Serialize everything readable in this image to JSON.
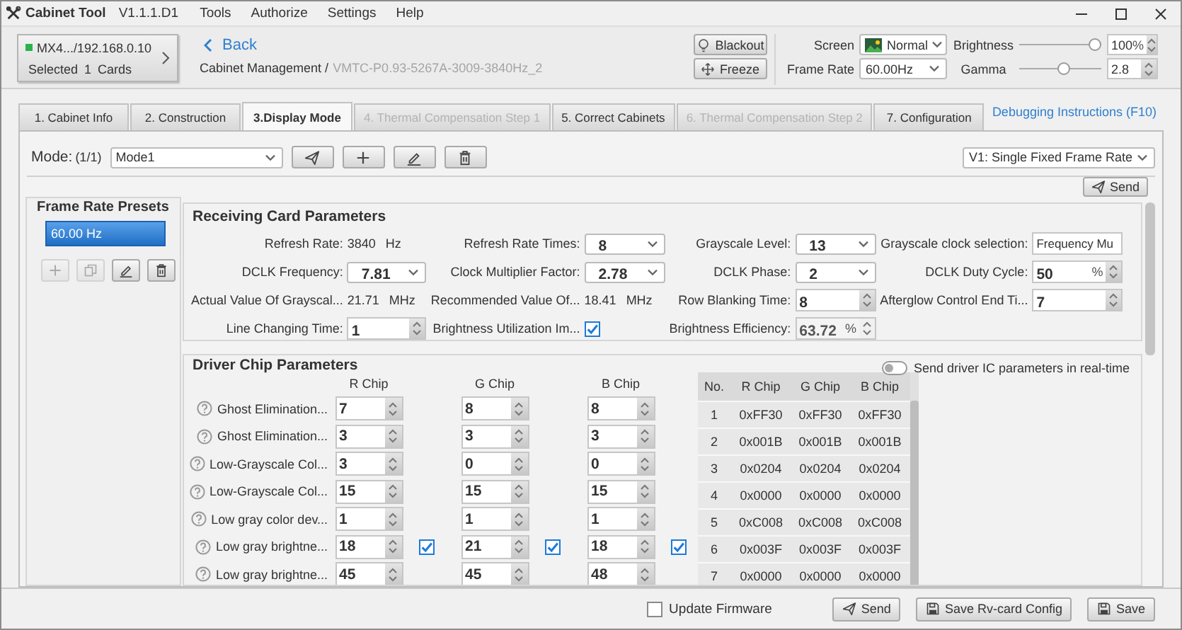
{
  "app": {
    "title": "Cabinet Tool",
    "version": "V1.1.1.D1"
  },
  "menu": [
    "Tools",
    "Authorize",
    "Settings",
    "Help"
  ],
  "device": {
    "name": "MX4.../192.168.0.10",
    "selection": "Selected 1 Cards",
    "online": true
  },
  "back": "Back",
  "breadcrumb": {
    "parent": "Cabinet Management /",
    "current": "VMTC-P0.93-5267A-3009-3840Hz_2"
  },
  "actions": [
    {
      "label": "Blackout",
      "kind": "blackout"
    },
    {
      "label": "Freeze",
      "kind": "freeze"
    }
  ],
  "screen": {
    "label": "Screen",
    "value": "Normal"
  },
  "brightness": {
    "label": "Brightness",
    "level": 1,
    "value": "100",
    "unit": "%"
  },
  "frame_rate": {
    "label": "Frame Rate",
    "value": "60.00Hz"
  },
  "gamma": {
    "label": "Gamma",
    "level": 0.55,
    "value": "2.8"
  },
  "tabs": [
    {
      "label": "1. Cabinet Info",
      "selected": false,
      "disabled": false
    },
    {
      "label": "2. Construction",
      "selected": false,
      "disabled": false
    },
    {
      "label": "3.Display Mode",
      "selected": true,
      "disabled": false
    },
    {
      "label": "4. Thermal Compensation Step 1",
      "selected": false,
      "disabled": true
    },
    {
      "label": "5. Correct Cabinets",
      "selected": false,
      "disabled": false
    },
    {
      "label": "6. Thermal Compensation Step 2",
      "selected": false,
      "disabled": true
    },
    {
      "label": "7. Configuration",
      "selected": false,
      "disabled": false
    }
  ],
  "help_link": "Debugging Instructions (F10)",
  "mode": {
    "label": "Mode:",
    "count": "(1/1)",
    "value": "Mode1"
  },
  "frame_mode": "V1: Single Fixed Frame Rate",
  "send": "Send",
  "presets": {
    "title": "Frame Rate Presets",
    "items": [
      {
        "label": "60.00 Hz",
        "selected": true
      }
    ],
    "tools": [
      {
        "kind": "add",
        "disabled": true
      },
      {
        "kind": "copy",
        "disabled": true
      },
      {
        "kind": "edit",
        "disabled": false
      },
      {
        "kind": "delete",
        "disabled": false
      }
    ]
  },
  "receiving_card": {
    "title": "Receiving Card Parameters",
    "fields": [
      {
        "kind": "readout",
        "label": "Refresh Rate:",
        "value": "3840",
        "unit": "Hz"
      },
      {
        "kind": "dropdown",
        "label": "Refresh Rate Times:",
        "value": "8"
      },
      {
        "kind": "dropdown",
        "label": "Grayscale Level:",
        "value": "13"
      },
      {
        "kind": "text",
        "label": "Grayscale clock selection:",
        "value": "Frequency Mu"
      },
      {
        "kind": "dropdown",
        "label": "DCLK Frequency:",
        "value": "7.81"
      },
      {
        "kind": "dropdown",
        "label": "Clock Multiplier Factor:",
        "value": "2.78"
      },
      {
        "kind": "dropdown",
        "label": "DCLK Phase:",
        "value": "2"
      },
      {
        "kind": "spin",
        "label": "DCLK Duty Cycle:",
        "value": "50",
        "unit": "%",
        "disabled": false
      },
      {
        "kind": "readout",
        "label": "Actual Value Of Grayscal...",
        "value": "21.71",
        "unit": "MHz"
      },
      {
        "kind": "readout",
        "label": "Recommended Value Of...",
        "value": "18.41",
        "unit": "MHz"
      },
      {
        "kind": "spin",
        "label": "Row Blanking Time:",
        "value": "8",
        "disabled": false
      },
      {
        "kind": "spin",
        "label": "Afterglow Control End Ti...",
        "value": "7",
        "disabled": false
      },
      {
        "kind": "spin",
        "label": "Line Changing Time:",
        "value": "1",
        "disabled": false
      },
      {
        "kind": "checkbox",
        "label": "Brightness Utilization Im...",
        "checked": true
      },
      {
        "kind": "spin",
        "label": "Brightness Efficiency:",
        "value": "63.72",
        "unit": "%",
        "disabled": true
      }
    ]
  },
  "driver": {
    "title": "Driver Chip Parameters",
    "realtime": {
      "label": "Send driver IC parameters in real-time",
      "on": false
    },
    "columns": [
      "R Chip",
      "G Chip",
      "B Chip"
    ],
    "rows": [
      {
        "label": "Ghost Elimination...",
        "values": [
          "7",
          "8",
          "8"
        ]
      },
      {
        "label": "Ghost Elimination...",
        "values": [
          "3",
          "3",
          "3"
        ]
      },
      {
        "label": "Low-Grayscale Col...",
        "values": [
          "3",
          "0",
          "0"
        ]
      },
      {
        "label": "Low-Grayscale Col...",
        "values": [
          "15",
          "15",
          "15"
        ]
      },
      {
        "label": "Low gray color dev...",
        "values": [
          "1",
          "1",
          "1"
        ]
      },
      {
        "label": "Low gray brightne...",
        "values": [
          "18",
          "21",
          "18"
        ],
        "checks": [
          true,
          true,
          true
        ]
      },
      {
        "label": "Low gray brightne...",
        "values": [
          "45",
          "45",
          "48"
        ]
      }
    ]
  },
  "registers": {
    "columns": [
      "No.",
      "R Chip",
      "G Chip",
      "B Chip"
    ],
    "rows": [
      [
        "1",
        "0xFF30",
        "0xFF30",
        "0xFF30"
      ],
      [
        "2",
        "0x001B",
        "0x001B",
        "0x001B"
      ],
      [
        "3",
        "0x0204",
        "0x0204",
        "0x0204"
      ],
      [
        "4",
        "0x0000",
        "0x0000",
        "0x0000"
      ],
      [
        "5",
        "0xC008",
        "0xC008",
        "0xC008"
      ],
      [
        "6",
        "0x003F",
        "0x003F",
        "0x003F"
      ],
      [
        "7",
        "0x0000",
        "0x0000",
        "0x0000"
      ]
    ]
  },
  "footer": {
    "update_firmware": {
      "label": "Update Firmware",
      "checked": false
    },
    "buttons": [
      {
        "label": "Send",
        "kind": "send"
      },
      {
        "label": "Save Rv-card Config",
        "kind": "save"
      },
      {
        "label": "Save",
        "kind": "save"
      }
    ]
  }
}
